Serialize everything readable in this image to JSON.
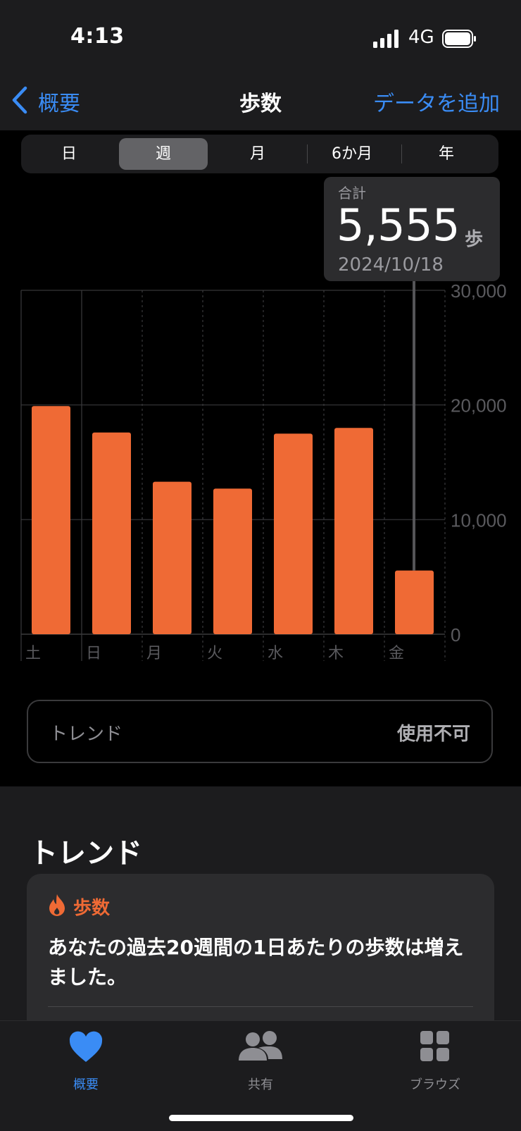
{
  "status_bar": {
    "time": "4:13",
    "network": "4G"
  },
  "nav": {
    "back_label": "概要",
    "title": "歩数",
    "action_label": "データを追加"
  },
  "segments": [
    "日",
    "週",
    "月",
    "6か月",
    "年"
  ],
  "selected_segment": "週",
  "tooltip": {
    "label": "合計",
    "value": "5,555",
    "unit": "歩",
    "date": "2024/10/18"
  },
  "accent_color": "#ef6a35",
  "link_color": "#3a8cf5",
  "chart_data": {
    "type": "bar",
    "categories": [
      "土",
      "日",
      "月",
      "火",
      "水",
      "木",
      "金"
    ],
    "values": [
      19900,
      17600,
      13300,
      12700,
      17500,
      18000,
      5555
    ],
    "ylim": [
      0,
      30000
    ],
    "yticks": [
      0,
      10000,
      20000,
      30000
    ],
    "ytick_labels": [
      "0",
      "10,000",
      "20,000",
      "30,000"
    ],
    "grid": true,
    "y_axis_side": "right",
    "highlighted": "金",
    "bar_color": "#ef6a35"
  },
  "trend_box": {
    "label": "トレンド",
    "status": "使用不可"
  },
  "trends_section": {
    "title": "トレンド",
    "card": {
      "category": "歩数",
      "text": "あなたの過去20週間の1日あたりの歩数は増えました。"
    }
  },
  "tabbar": {
    "items": [
      {
        "label": "概要",
        "icon": "heart-icon",
        "selected": true
      },
      {
        "label": "共有",
        "icon": "people-icon",
        "selected": false
      },
      {
        "label": "ブラウズ",
        "icon": "grid-icon",
        "selected": false
      }
    ]
  }
}
